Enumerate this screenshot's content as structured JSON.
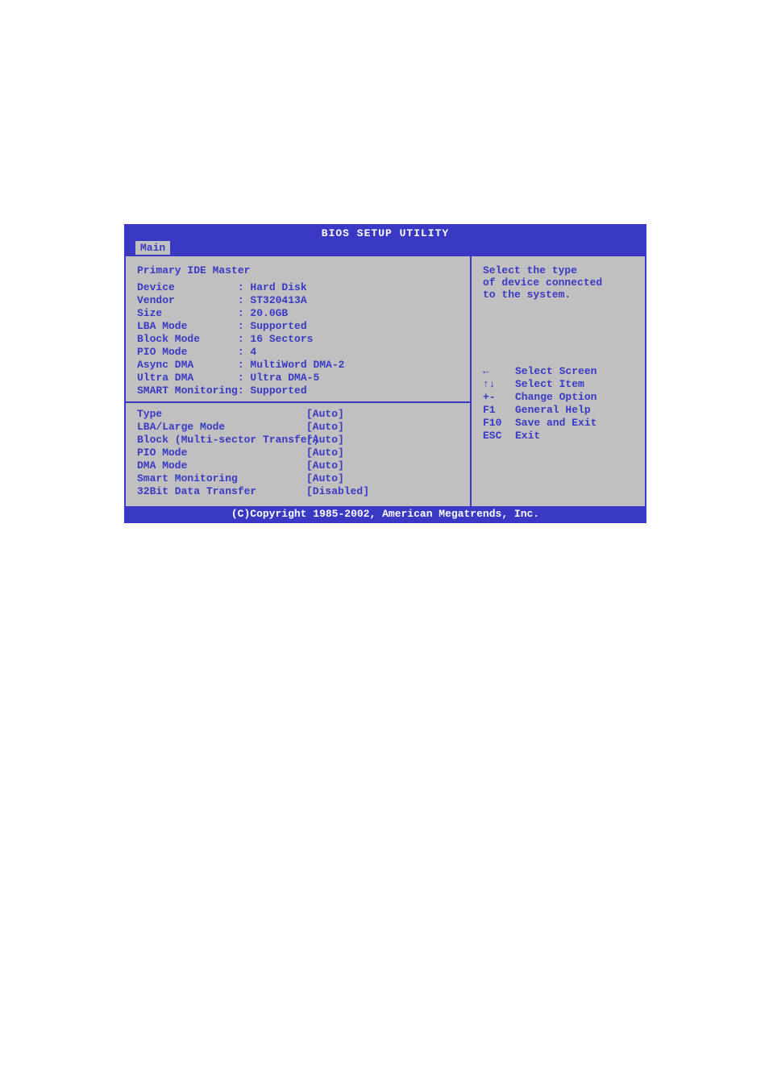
{
  "title": "BIOS SETUP UTILITY",
  "tab": "Main",
  "section_title": "Primary IDE Master",
  "device_info": [
    {
      "label": "Device          ",
      "value": ": Hard Disk"
    },
    {
      "label": "Vendor          ",
      "value": ": ST320413A"
    },
    {
      "label": "Size            ",
      "value": ": 20.0GB"
    },
    {
      "label": "LBA Mode        ",
      "value": ": Supported"
    },
    {
      "label": "Block Mode      ",
      "value": ": 16 Sectors"
    },
    {
      "label": "PIO Mode        ",
      "value": ": 4"
    },
    {
      "label": "Async DMA       ",
      "value": ": MultiWord DMA-2"
    },
    {
      "label": "Ultra DMA       ",
      "value": ": Ultra DMA-5"
    },
    {
      "label": "SMART Monitoring",
      "value": ": Supported"
    }
  ],
  "options": [
    {
      "label": "Type",
      "value": "[Auto]"
    },
    {
      "label": "LBA/Large Mode",
      "value": "[Auto]"
    },
    {
      "label": "Block (Multi-sector Transfer)",
      "value": "[Auto]"
    },
    {
      "label": "PIO Mode",
      "value": "[Auto]"
    },
    {
      "label": "DMA Mode",
      "value": "[Auto]"
    },
    {
      "label": "Smart Monitoring",
      "value": "[Auto]"
    },
    {
      "label": "32Bit Data Transfer",
      "value": "[Disabled]"
    }
  ],
  "help_text": "Select the type\nof device connected\nto the system.",
  "key_hints": [
    {
      "key": "←",
      "label": "Select Screen"
    },
    {
      "key": "↑↓",
      "label": "Select Item"
    },
    {
      "key": "+-",
      "label": "Change Option"
    },
    {
      "key": "F1",
      "label": "General Help"
    },
    {
      "key": "F10",
      "label": "Save and Exit"
    },
    {
      "key": "ESC",
      "label": "Exit"
    }
  ],
  "footer": "(C)Copyright 1985-2002, American Megatrends, Inc."
}
